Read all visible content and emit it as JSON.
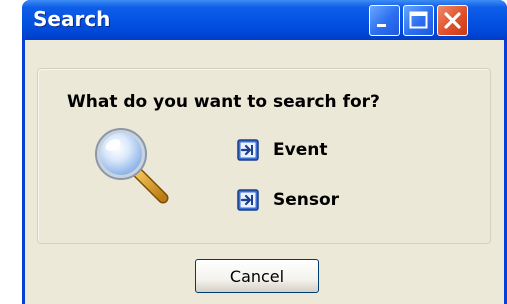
{
  "window": {
    "title": "Search",
    "controls": {
      "minimize_icon": "minimize-icon",
      "maximize_icon": "maximize-icon",
      "close_icon": "close-icon"
    }
  },
  "prompt": "What do you want to search for?",
  "illustration_icon": "magnifier-icon",
  "options": [
    {
      "label": "Event",
      "icon": "arrow-right-icon"
    },
    {
      "label": "Sensor",
      "icon": "arrow-right-icon"
    }
  ],
  "buttons": {
    "cancel_label": "Cancel"
  },
  "colors": {
    "titlebar": "#0553e3",
    "dialog_body": "#ece9d8",
    "close_button": "#e0512b",
    "option_icon": "#3a6fd8"
  }
}
